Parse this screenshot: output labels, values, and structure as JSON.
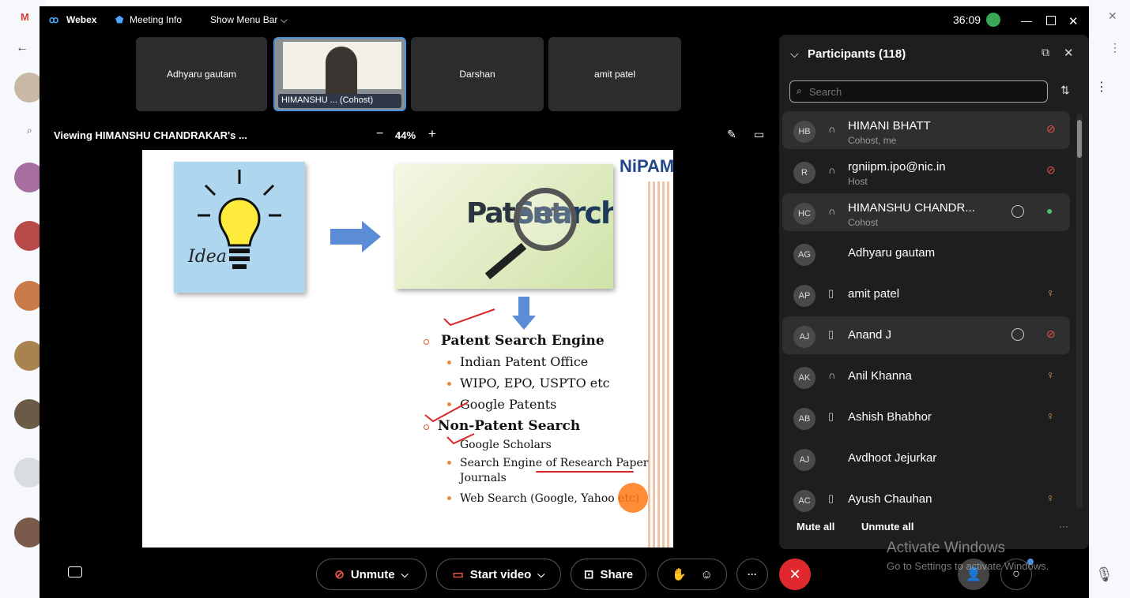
{
  "window": {
    "app_name": "Webex",
    "meeting_info": "Meeting Info",
    "show_menu_bar": "Show Menu Bar",
    "timer": "36:09"
  },
  "video_tiles": [
    {
      "label": "Adhyaru gautam"
    },
    {
      "label": "HIMANSHU ... (Cohost)"
    },
    {
      "label": "Darshan"
    },
    {
      "label": "amit patel"
    }
  ],
  "share": {
    "viewing": "Viewing HIMANSHU CHANDRAKAR's ...",
    "zoom": "44%",
    "minus": "−",
    "plus": "+"
  },
  "slide": {
    "logo": "NiPAM",
    "idea_word": "Idea",
    "patent_word": "Patent",
    "search_word": "Search",
    "items": {
      "patent_search_engine": "Patent Search Engine",
      "indian_patent_office": "Indian Patent Office",
      "wipo": "WIPO, EPO, USPTO etc",
      "google_patents": "Google Patents",
      "non_patent_search": "Non-Patent Search",
      "google_scholars": "Google Scholars",
      "search_engine_1": "Search Engine of Research Paper",
      "search_engine_2": "Journals",
      "web_search": "Web Search (Google, Yahoo etc)"
    }
  },
  "participants": {
    "title": "Participants (118)",
    "search_placeholder": "Search",
    "mute_all": "Mute all",
    "unmute_all": "Unmute all",
    "more": "···",
    "list": [
      {
        "initials": "HB",
        "name": "HIMANI BHATT",
        "role": "Cohost, me"
      },
      {
        "initials": "R",
        "name": "rgniipm.ipo@nic.in",
        "role": "Host"
      },
      {
        "initials": "HC",
        "name": "HIMANSHU CHANDR...",
        "role": "Cohost"
      },
      {
        "initials": "AG",
        "name": "Adhyaru gautam",
        "role": ""
      },
      {
        "initials": "AP",
        "name": "amit patel",
        "role": ""
      },
      {
        "initials": "AJ",
        "name": "Anand J",
        "role": ""
      },
      {
        "initials": "AK",
        "name": "Anil Khanna",
        "role": ""
      },
      {
        "initials": "AB",
        "name": "Ashish Bhabhor",
        "role": ""
      },
      {
        "initials": "AJ",
        "name": "Avdhoot Jejurkar",
        "role": ""
      },
      {
        "initials": "AC",
        "name": "Ayush Chauhan",
        "role": ""
      }
    ]
  },
  "controls": {
    "unmute": "Unmute",
    "start_video": "Start video",
    "share": "Share",
    "more": "···"
  },
  "watermark": {
    "line1": "Activate Windows",
    "line2": "Go to Settings to activate Windows."
  },
  "colors": {
    "end_button": "#e0282e",
    "mic_muted": "#e5534b",
    "mic_active": "#4cc36a",
    "accent_blue": "#4a90d9"
  }
}
